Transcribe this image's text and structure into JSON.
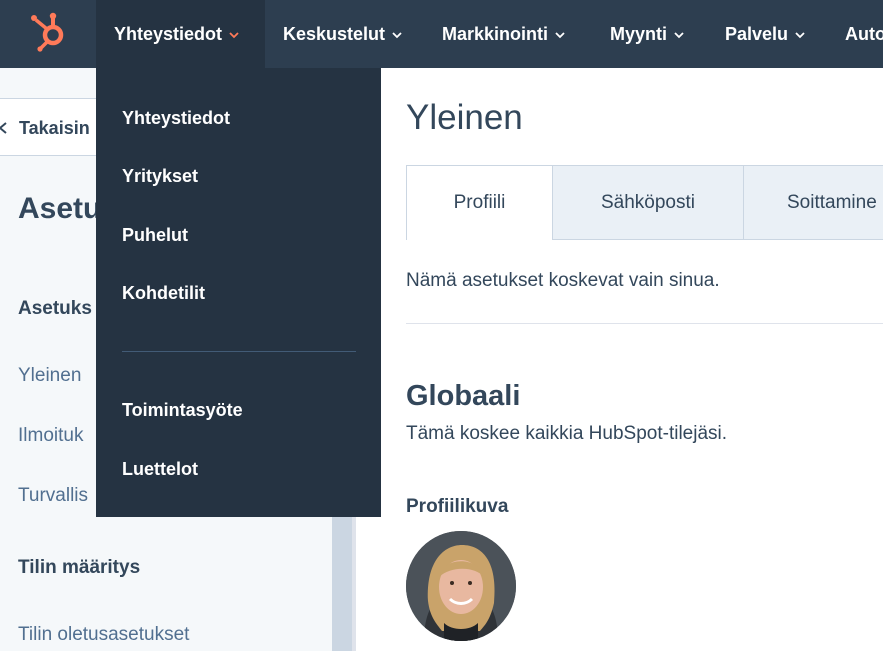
{
  "topnav": {
    "logo": "hubspot-sprocket-icon",
    "items": [
      {
        "label": "Yhteystiedot"
      },
      {
        "label": "Keskustelut"
      },
      {
        "label": "Markkinointi"
      },
      {
        "label": "Myynti"
      },
      {
        "label": "Palvelu"
      },
      {
        "label": "Auto"
      }
    ]
  },
  "dropdown": {
    "items": [
      {
        "label": "Yhteystiedot"
      },
      {
        "label": "Yritykset"
      },
      {
        "label": "Puhelut"
      },
      {
        "label": "Kohdetilit"
      },
      {
        "label": "Toimintasyöte"
      },
      {
        "label": "Luettelot"
      }
    ]
  },
  "sidebar": {
    "back_label": "Takaisin",
    "title": "Asetu",
    "section1": "Asetuks",
    "links": [
      {
        "label": "Yleinen"
      },
      {
        "label": "Ilmoituk"
      },
      {
        "label": "Turvallis"
      }
    ],
    "section2": "Tilin määritys",
    "link_default": "Tilin oletusasetukset"
  },
  "main": {
    "title": "Yleinen",
    "tabs": [
      {
        "label": "Profiili"
      },
      {
        "label": "Sähköposti"
      },
      {
        "label": "Soittamine"
      }
    ],
    "info": "Nämä asetukset koskevat vain sinua.",
    "global_heading": "Globaali",
    "global_sub": "Tämä koskee kaikkia HubSpot-tilejäsi.",
    "profile_picture_label": "Profiilikuva"
  },
  "colors": {
    "nav_bg": "#2d3e50",
    "dropdown_bg": "#253342",
    "accent_orange": "#ff7a59",
    "text": "#33475b"
  }
}
